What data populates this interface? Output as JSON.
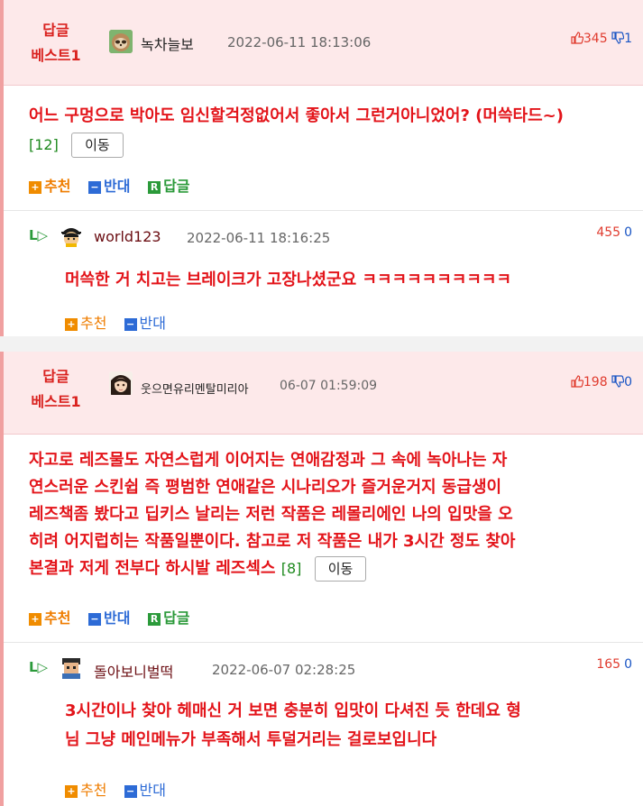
{
  "comments": [
    {
      "best_line1": "답글",
      "best_line2": "베스트1",
      "nickname": "녹차늘보",
      "date": "2022-06-11 18:13:06",
      "votes_up": "345",
      "votes_down": "1",
      "body": "어느 구멍으로 박아도 임신할걱정없어서 좋아서 그런거아니었어? (머쓱타드~)",
      "ref": "[12]",
      "move_label": "이동",
      "actions": {
        "up": "추천",
        "down": "반대",
        "reply": "답글"
      },
      "badges": {
        "up": "+",
        "down": "−",
        "reply": "R"
      },
      "reply": {
        "arrow": "L▷",
        "nickname": "world123",
        "date": "2022-06-11 18:16:25",
        "votes_up": "455",
        "votes_down": "0",
        "body": "머쓱한 거 치고는 브레이크가 고장나셨군요 ㅋㅋㅋㅋㅋㅋㅋㅋㅋㅋ",
        "actions": {
          "up": "추천",
          "down": "반대"
        }
      }
    },
    {
      "best_line1": "답글",
      "best_line2": "베스트1",
      "nickname": "웃으면유리멘탈미리아",
      "date": "06-07 01:59:09",
      "votes_up": "198",
      "votes_down": "0",
      "body_lines": [
        "자고로 레즈물도 자연스럽게 이어지는 연애감정과 그 속에 녹아나는 자",
        "연스러운 스킨쉽 즉 평범한 연애같은 시나리오가 즐거운거지 동급생이",
        "레즈책좀 봤다고 딥키스 날리는 저런 작품은 레몰리에인 나의 입맛을 오",
        "히려 어지럽히는 작품일뿐이다. 참고로 저 작품은 내가 3시간 정도 찾아",
        "본결과 저게 전부다 하시발 레즈섹스"
      ],
      "ref": "[8]",
      "move_label": "이동",
      "actions": {
        "up": "추천",
        "down": "반대",
        "reply": "답글"
      },
      "badges": {
        "up": "+",
        "down": "−",
        "reply": "R"
      },
      "reply": {
        "arrow": "L▷",
        "nickname": "돌아보니벌떡",
        "date": "2022-06-07 02:28:25",
        "votes_up": "165",
        "votes_down": "0",
        "body_lines": [
          "3시간이나 찾아 헤매신 거 보면 충분히 입맛이 다셔진 듯 한데요 형",
          "님 그냥 메인메뉴가 부족해서 투덜거리는 걸로보입니다"
        ],
        "actions": {
          "up": "추천",
          "down": "반대"
        }
      }
    }
  ]
}
